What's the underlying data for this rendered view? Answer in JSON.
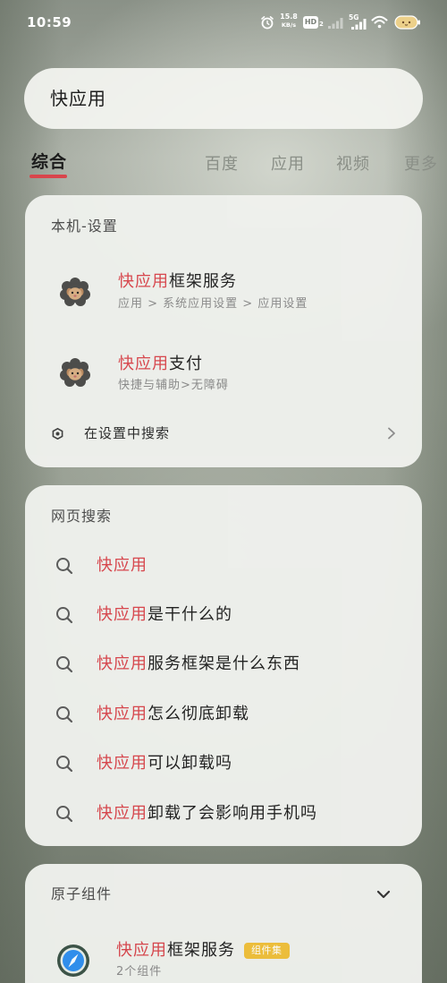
{
  "status_bar": {
    "time": "10:59",
    "net_speed": "15.8",
    "net_speed_unit": "KB/s",
    "hd_label": "HD",
    "hd_index": "2",
    "network_type": "5G",
    "icons": [
      "alarm-icon",
      "hd-voice-icon",
      "signal-icon",
      "wifi-icon",
      "battery-icon"
    ]
  },
  "search": {
    "query": "快应用"
  },
  "tabs": [
    {
      "label": "综合",
      "active": true
    },
    {
      "label": "百度",
      "active": false
    },
    {
      "label": "应用",
      "active": false
    },
    {
      "label": "视频",
      "active": false
    },
    {
      "label": "更多",
      "active": false
    }
  ],
  "local_settings": {
    "title": "本机-设置",
    "items": [
      {
        "icon": "settings-mascot-icon",
        "title_highlight": "快应用",
        "title_rest": "框架服务",
        "path": "应用 > 系统应用设置 > 应用设置"
      },
      {
        "icon": "settings-mascot-icon",
        "title_highlight": "快应用",
        "title_rest": "支付",
        "path": "快捷与辅助>无障碍"
      }
    ],
    "search_in_settings": {
      "icon": "settings-hex-icon",
      "label": "在设置中搜索"
    }
  },
  "web_search": {
    "title": "网页搜索",
    "suggestions": [
      {
        "highlight": "快应用"
      },
      {
        "highlight": "快应用",
        "rest": "是干什么的"
      },
      {
        "highlight": "快应用",
        "rest": "服务框架是什么东西"
      },
      {
        "highlight": "快应用",
        "rest": "怎么彻底卸载"
      },
      {
        "highlight": "快应用",
        "rest": "可以卸载吗"
      },
      {
        "highlight": "快应用",
        "rest": "卸载了会影响用手机吗"
      }
    ]
  },
  "atomic_components": {
    "title": "原子组件",
    "items": [
      {
        "icon": "quick-app-compass-icon",
        "title_highlight": "快应用",
        "title_rest": "框架服务",
        "badge": "组件集",
        "count_label": "2个组件"
      }
    ]
  },
  "colors": {
    "highlight": "#d9454c",
    "tab_active": "#1c1c1c",
    "tab_inactive": "#8a8f87",
    "badge": "#f0c03a",
    "card": "#eff1ed"
  }
}
